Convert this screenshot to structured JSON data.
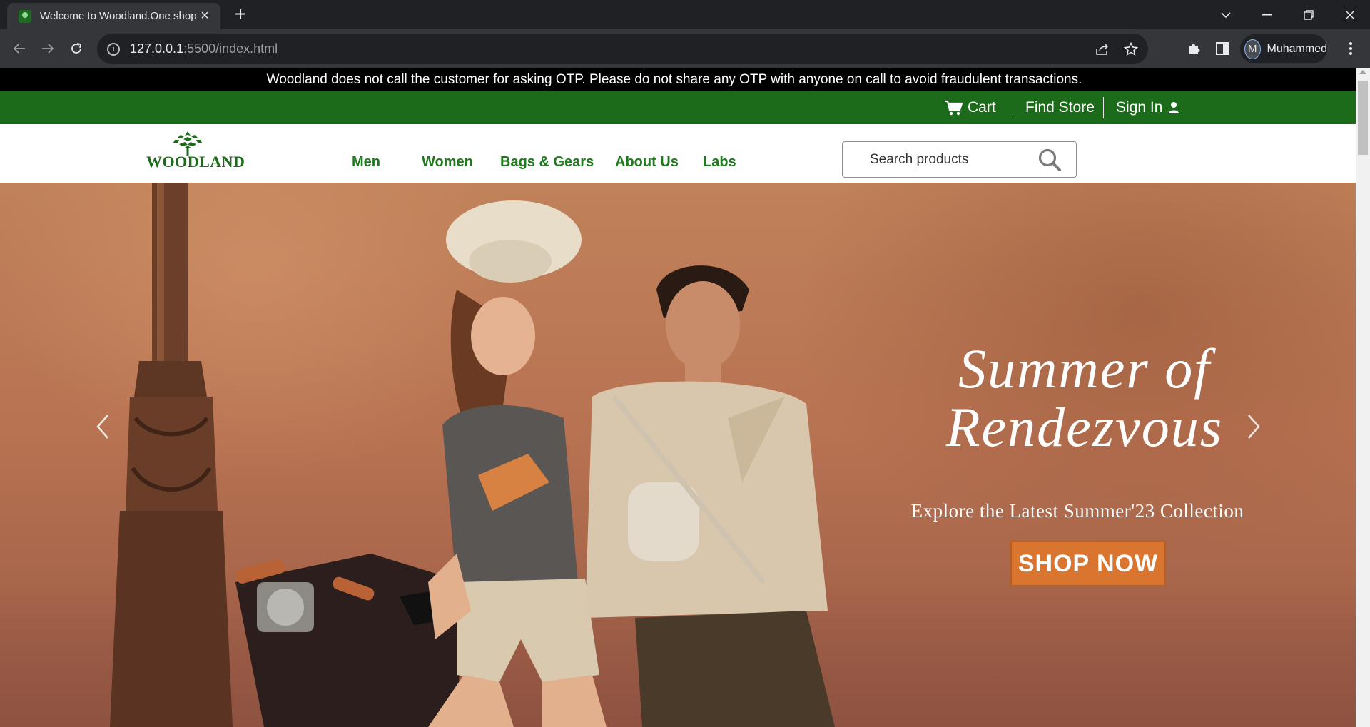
{
  "browser": {
    "tab_title": "Welcome to Woodland.One shop",
    "url_host": "127.0.0.1",
    "url_path": ":5500/index.html",
    "profile_name": "Muhammed",
    "profile_initial": "M",
    "new_tab_icon": "plus-icon",
    "close_tab_icon": "close-icon"
  },
  "site": {
    "notice": "Woodland does not call the customer for asking OTP. Please do not share any OTP with anyone on call to avoid fraudulent transactions.",
    "util": {
      "cart": "Cart",
      "find_store": "Find Store",
      "sign_in": "Sign In"
    },
    "logo_text": "WOODLAND",
    "nav": [
      "Men",
      "Women",
      "Bags & Gears",
      "About Us",
      "Labs"
    ],
    "search_placeholder": "Search products",
    "hero": {
      "title_line1": "Summer of",
      "title_line2": "Rendezvous",
      "subtitle": "Explore the Latest Summer'23 Collection",
      "cta": "SHOP NOW"
    },
    "colors": {
      "brand_green": "#1c6b1a",
      "nav_green": "#1f7a1e",
      "cta_orange": "#d9752e"
    }
  }
}
